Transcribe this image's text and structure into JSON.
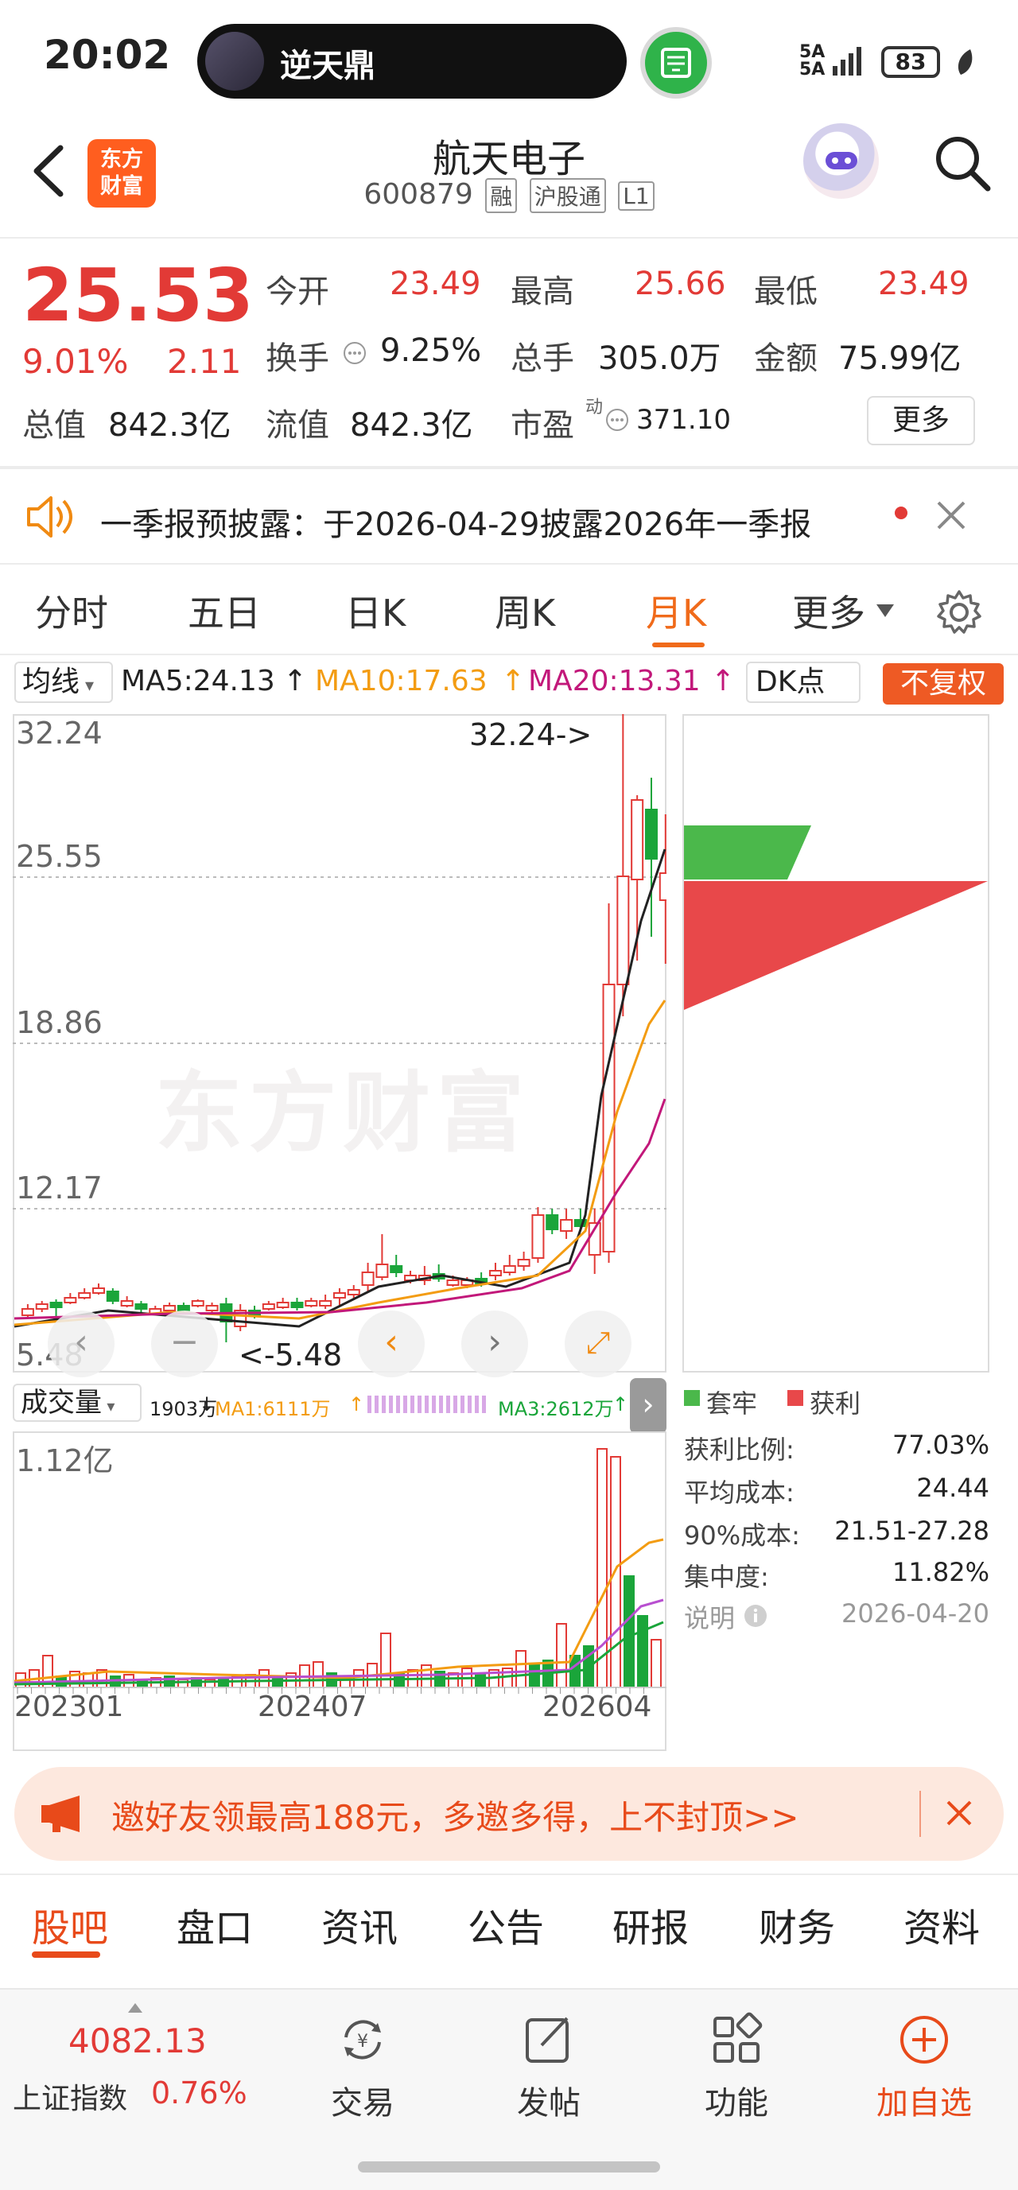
{
  "status_bar": {
    "time": "20:02",
    "pill_title": "逆天鼎",
    "signal_top": "5A",
    "signal_bottom": "5A",
    "battery": "83"
  },
  "header": {
    "logo_line1": "东方",
    "logo_line2": "财富",
    "stock_name": "航天电子",
    "stock_code": "600879",
    "tags": [
      "融",
      "沪股通",
      "L1"
    ]
  },
  "quote": {
    "price": "25.53",
    "change_pct": "9.01%",
    "change": "2.11",
    "stats": [
      {
        "label": "今开",
        "value": "23.49",
        "color": "red"
      },
      {
        "label": "最高",
        "value": "25.66",
        "color": "red"
      },
      {
        "label": "最低",
        "value": "23.49",
        "color": "red"
      },
      {
        "label": "换手",
        "value": "9.25%",
        "color": "plain"
      },
      {
        "label": "总手",
        "value": "305.0万",
        "color": "plain"
      },
      {
        "label": "金额",
        "value": "75.99亿",
        "color": "plain"
      },
      {
        "label": "总值",
        "value": "842.3亿",
        "color": "plain"
      },
      {
        "label": "流值",
        "value": "842.3亿",
        "color": "plain"
      },
      {
        "label": "市盈",
        "value": "371.10",
        "color": "plain"
      }
    ],
    "pe_superscript": "动",
    "more_label": "更多"
  },
  "notice": {
    "text": "一季报预披露：于2026-04-29披露2026年一季报"
  },
  "period_tabs": {
    "items": [
      "分时",
      "五日",
      "日K",
      "周K",
      "月K",
      "更多"
    ],
    "active": "月K"
  },
  "ma": {
    "selector": "均线",
    "ma5": "MA5:24.13",
    "ma10": "MA10:17.63",
    "ma20": "MA20:13.31",
    "dk": "DK点",
    "restore": "不复权",
    "ma5_color": "#222222",
    "ma10_color": "#f39c12",
    "ma20_color": "#c2187a"
  },
  "kline": {
    "y_labels": [
      "32.24",
      "25.55",
      "18.86",
      "12.17",
      "5.48"
    ],
    "max_marker": "32.24->",
    "min_marker": "<-5.48",
    "watermark": "东方财富"
  },
  "chip": {
    "legend_hold": "套牢",
    "legend_profit": "获利",
    "hold_color": "#4bb84b",
    "profit_color": "#e8484a",
    "rows": [
      {
        "label": "获利比例:",
        "value": "77.03%"
      },
      {
        "label": "平均成本:",
        "value": "24.44"
      },
      {
        "label": "90%成本:",
        "value": "21.51-27.28"
      },
      {
        "label": "集中度:",
        "value": "11.82%"
      },
      {
        "label": "说明",
        "value": "2026-04-20"
      }
    ]
  },
  "volume": {
    "selector": "成交量",
    "vol": "1903万",
    "ma1": "MA1:6111万",
    "ma3": "MA3:2612万",
    "y_label": "1.12亿",
    "x_labels": [
      "202301",
      "202407",
      "202604"
    ]
  },
  "promo": {
    "text": "邀好友领最高188元，多邀多得，上不封顶>>"
  },
  "bottom_tabs": {
    "items": [
      "股吧",
      "盘口",
      "资讯",
      "公告",
      "研报",
      "财务",
      "资料"
    ],
    "active": "股吧"
  },
  "bottom_nav": {
    "index_value": "4082.13",
    "index_name": "上证指数",
    "index_pct": "0.76%",
    "items": [
      "交易",
      "发帖",
      "功能",
      "加自选"
    ]
  }
}
